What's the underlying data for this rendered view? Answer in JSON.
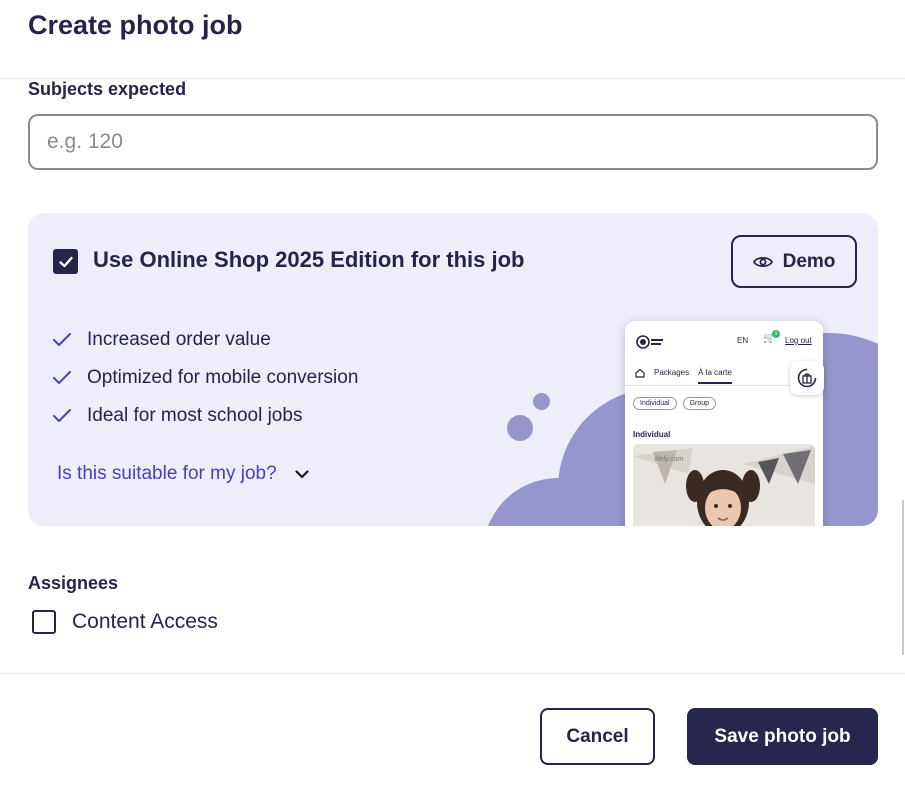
{
  "dialog": {
    "title": "Create photo job"
  },
  "subjects": {
    "label": "Subjects expected",
    "placeholder": "e.g. 120",
    "value": ""
  },
  "promo": {
    "checked": true,
    "title": "Use Online Shop 2025 Edition for this job",
    "demo_label": "Demo",
    "features": [
      "Increased order value",
      "Optimized for mobile conversion",
      "Ideal for most school jobs"
    ],
    "suitable_link": "Is this suitable for my job?",
    "preview": {
      "lang": "EN",
      "cart_count": "1",
      "logout": "Log out",
      "tabs": [
        "Packages",
        "À la carte"
      ],
      "chips": [
        "Individual",
        "Group"
      ],
      "section": "Individual",
      "watermark": "lilely.com"
    }
  },
  "assignees": {
    "label": "Assignees",
    "option": "Content Access",
    "checked": false
  },
  "footer": {
    "cancel_label": "Cancel",
    "save_label": "Save photo job"
  },
  "colors": {
    "primary": "#27264f",
    "accent": "#4b3fb8",
    "panel": "#eeeefa",
    "blob": "#9597cc"
  }
}
